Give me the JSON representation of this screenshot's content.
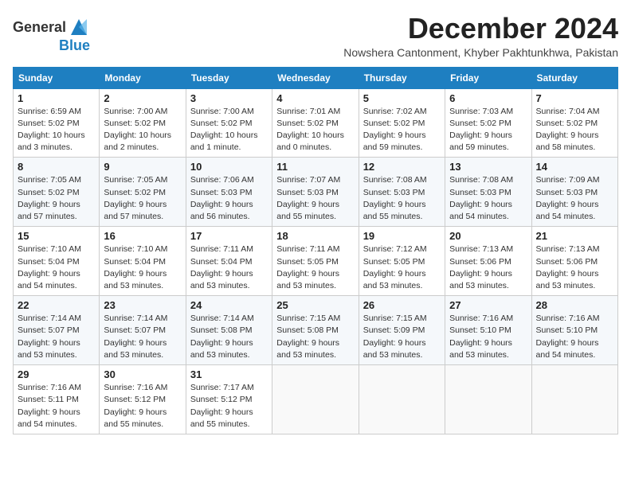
{
  "header": {
    "logo_general": "General",
    "logo_blue": "Blue",
    "month_title": "December 2024",
    "subtitle": "Nowshera Cantonment, Khyber Pakhtunkhwa, Pakistan"
  },
  "days_of_week": [
    "Sunday",
    "Monday",
    "Tuesday",
    "Wednesday",
    "Thursday",
    "Friday",
    "Saturday"
  ],
  "weeks": [
    [
      {
        "day": "1",
        "sunrise": "Sunrise: 6:59 AM",
        "sunset": "Sunset: 5:02 PM",
        "daylight": "Daylight: 10 hours and 3 minutes."
      },
      {
        "day": "2",
        "sunrise": "Sunrise: 7:00 AM",
        "sunset": "Sunset: 5:02 PM",
        "daylight": "Daylight: 10 hours and 2 minutes."
      },
      {
        "day": "3",
        "sunrise": "Sunrise: 7:00 AM",
        "sunset": "Sunset: 5:02 PM",
        "daylight": "Daylight: 10 hours and 1 minute."
      },
      {
        "day": "4",
        "sunrise": "Sunrise: 7:01 AM",
        "sunset": "Sunset: 5:02 PM",
        "daylight": "Daylight: 10 hours and 0 minutes."
      },
      {
        "day": "5",
        "sunrise": "Sunrise: 7:02 AM",
        "sunset": "Sunset: 5:02 PM",
        "daylight": "Daylight: 9 hours and 59 minutes."
      },
      {
        "day": "6",
        "sunrise": "Sunrise: 7:03 AM",
        "sunset": "Sunset: 5:02 PM",
        "daylight": "Daylight: 9 hours and 59 minutes."
      },
      {
        "day": "7",
        "sunrise": "Sunrise: 7:04 AM",
        "sunset": "Sunset: 5:02 PM",
        "daylight": "Daylight: 9 hours and 58 minutes."
      }
    ],
    [
      {
        "day": "8",
        "sunrise": "Sunrise: 7:05 AM",
        "sunset": "Sunset: 5:02 PM",
        "daylight": "Daylight: 9 hours and 57 minutes."
      },
      {
        "day": "9",
        "sunrise": "Sunrise: 7:05 AM",
        "sunset": "Sunset: 5:02 PM",
        "daylight": "Daylight: 9 hours and 57 minutes."
      },
      {
        "day": "10",
        "sunrise": "Sunrise: 7:06 AM",
        "sunset": "Sunset: 5:03 PM",
        "daylight": "Daylight: 9 hours and 56 minutes."
      },
      {
        "day": "11",
        "sunrise": "Sunrise: 7:07 AM",
        "sunset": "Sunset: 5:03 PM",
        "daylight": "Daylight: 9 hours and 55 minutes."
      },
      {
        "day": "12",
        "sunrise": "Sunrise: 7:08 AM",
        "sunset": "Sunset: 5:03 PM",
        "daylight": "Daylight: 9 hours and 55 minutes."
      },
      {
        "day": "13",
        "sunrise": "Sunrise: 7:08 AM",
        "sunset": "Sunset: 5:03 PM",
        "daylight": "Daylight: 9 hours and 54 minutes."
      },
      {
        "day": "14",
        "sunrise": "Sunrise: 7:09 AM",
        "sunset": "Sunset: 5:03 PM",
        "daylight": "Daylight: 9 hours and 54 minutes."
      }
    ],
    [
      {
        "day": "15",
        "sunrise": "Sunrise: 7:10 AM",
        "sunset": "Sunset: 5:04 PM",
        "daylight": "Daylight: 9 hours and 54 minutes."
      },
      {
        "day": "16",
        "sunrise": "Sunrise: 7:10 AM",
        "sunset": "Sunset: 5:04 PM",
        "daylight": "Daylight: 9 hours and 53 minutes."
      },
      {
        "day": "17",
        "sunrise": "Sunrise: 7:11 AM",
        "sunset": "Sunset: 5:04 PM",
        "daylight": "Daylight: 9 hours and 53 minutes."
      },
      {
        "day": "18",
        "sunrise": "Sunrise: 7:11 AM",
        "sunset": "Sunset: 5:05 PM",
        "daylight": "Daylight: 9 hours and 53 minutes."
      },
      {
        "day": "19",
        "sunrise": "Sunrise: 7:12 AM",
        "sunset": "Sunset: 5:05 PM",
        "daylight": "Daylight: 9 hours and 53 minutes."
      },
      {
        "day": "20",
        "sunrise": "Sunrise: 7:13 AM",
        "sunset": "Sunset: 5:06 PM",
        "daylight": "Daylight: 9 hours and 53 minutes."
      },
      {
        "day": "21",
        "sunrise": "Sunrise: 7:13 AM",
        "sunset": "Sunset: 5:06 PM",
        "daylight": "Daylight: 9 hours and 53 minutes."
      }
    ],
    [
      {
        "day": "22",
        "sunrise": "Sunrise: 7:14 AM",
        "sunset": "Sunset: 5:07 PM",
        "daylight": "Daylight: 9 hours and 53 minutes."
      },
      {
        "day": "23",
        "sunrise": "Sunrise: 7:14 AM",
        "sunset": "Sunset: 5:07 PM",
        "daylight": "Daylight: 9 hours and 53 minutes."
      },
      {
        "day": "24",
        "sunrise": "Sunrise: 7:14 AM",
        "sunset": "Sunset: 5:08 PM",
        "daylight": "Daylight: 9 hours and 53 minutes."
      },
      {
        "day": "25",
        "sunrise": "Sunrise: 7:15 AM",
        "sunset": "Sunset: 5:08 PM",
        "daylight": "Daylight: 9 hours and 53 minutes."
      },
      {
        "day": "26",
        "sunrise": "Sunrise: 7:15 AM",
        "sunset": "Sunset: 5:09 PM",
        "daylight": "Daylight: 9 hours and 53 minutes."
      },
      {
        "day": "27",
        "sunrise": "Sunrise: 7:16 AM",
        "sunset": "Sunset: 5:10 PM",
        "daylight": "Daylight: 9 hours and 53 minutes."
      },
      {
        "day": "28",
        "sunrise": "Sunrise: 7:16 AM",
        "sunset": "Sunset: 5:10 PM",
        "daylight": "Daylight: 9 hours and 54 minutes."
      }
    ],
    [
      {
        "day": "29",
        "sunrise": "Sunrise: 7:16 AM",
        "sunset": "Sunset: 5:11 PM",
        "daylight": "Daylight: 9 hours and 54 minutes."
      },
      {
        "day": "30",
        "sunrise": "Sunrise: 7:16 AM",
        "sunset": "Sunset: 5:12 PM",
        "daylight": "Daylight: 9 hours and 55 minutes."
      },
      {
        "day": "31",
        "sunrise": "Sunrise: 7:17 AM",
        "sunset": "Sunset: 5:12 PM",
        "daylight": "Daylight: 9 hours and 55 minutes."
      },
      null,
      null,
      null,
      null
    ]
  ]
}
